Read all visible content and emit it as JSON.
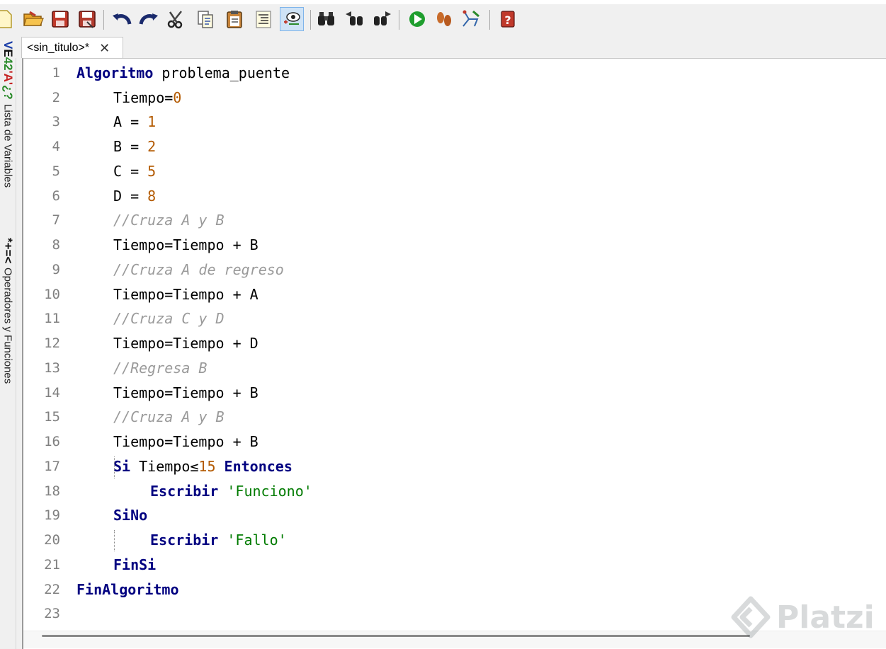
{
  "tab": {
    "title": "<sin_titulo>*",
    "close": "✕"
  },
  "side_tabs": {
    "variables_label": "Lista de Variables",
    "operators_label": "Operadores y Funciones",
    "icon1_a": "V",
    "icon1_b": "E",
    "icon1_c": "42",
    "icon1_d": "'A'",
    "icon1_e": "¿?",
    "icon2": "*+=<"
  },
  "gutter": [
    "1",
    "2",
    "3",
    "4",
    "5",
    "6",
    "7",
    "8",
    "9",
    "10",
    "11",
    "12",
    "13",
    "14",
    "15",
    "16",
    "17",
    "18",
    "19",
    "20",
    "21",
    "22",
    "23"
  ],
  "code": {
    "l1": {
      "kw": "Algoritmo",
      "rest": " problema_puente"
    },
    "l2": {
      "text": "Tiempo=",
      "num": "0"
    },
    "l3": {
      "text": "A = ",
      "num": "1"
    },
    "l4": {
      "text": "B = ",
      "num": "2"
    },
    "l5": {
      "text": "C = ",
      "num": "5"
    },
    "l6": {
      "text": "D = ",
      "num": "8"
    },
    "l7": {
      "comment": "//Cruza A y B"
    },
    "l8": {
      "text": "Tiempo=Tiempo + B"
    },
    "l9": {
      "comment": "//Cruza A de regreso"
    },
    "l10": {
      "text": "Tiempo=Tiempo + A"
    },
    "l11": {
      "comment": "//Cruza C y D"
    },
    "l12": {
      "text": "Tiempo=Tiempo + D"
    },
    "l13": {
      "comment": "//Regresa B"
    },
    "l14": {
      "text": "Tiempo=Tiempo + B"
    },
    "l15": {
      "comment": "//Cruza A y B"
    },
    "l16": {
      "text": "Tiempo=Tiempo + B"
    },
    "l17": {
      "kw1": "Si",
      "text": " Tiempo≤",
      "num": "15",
      "kw2": " Entonces"
    },
    "l18": {
      "kw": "Escribir",
      "str": " 'Funciono'"
    },
    "l19": {
      "kw": "SiNo"
    },
    "l20": {
      "kw": "Escribir",
      "str": " 'Fallo'"
    },
    "l21": {
      "kw": "FinSi"
    },
    "l22": {
      "kw": "FinAlgoritmo"
    }
  },
  "watermark": {
    "text": "Platzi"
  },
  "colors": {
    "keyword": "#000080",
    "number": "#b35a00",
    "comment": "#9a9a9a",
    "string": "#007b00",
    "line_number": "#808080"
  }
}
